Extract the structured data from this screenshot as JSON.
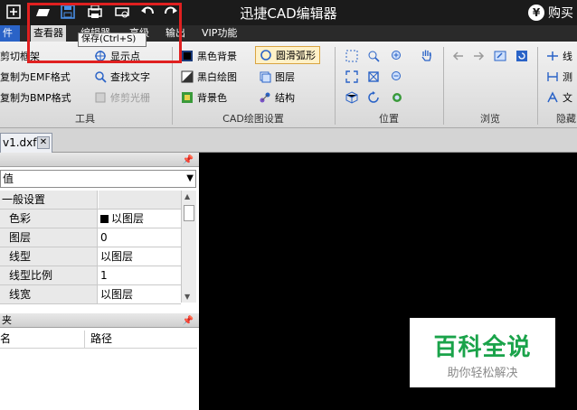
{
  "app": {
    "title": "迅捷CAD编辑器",
    "buy_label": "购买",
    "buy_icon": "yen-icon"
  },
  "quick_access": [
    "new-icon",
    "open-icon",
    "save-icon",
    "print-icon",
    "print-preview-icon",
    "undo-icon",
    "redo-icon"
  ],
  "menu": {
    "tabs": [
      "件",
      "查看器",
      "编辑器",
      "高级",
      "输出",
      "VIP功能"
    ],
    "active_tab": "查看器"
  },
  "tooltip": "保存(Ctrl+S)",
  "ribbon": {
    "tools": {
      "label": "工具",
      "items": [
        {
          "label": "剪切框架",
          "icon": "scissors-icon"
        },
        {
          "label": "复制为EMF格式",
          "icon": "copy-emf-icon"
        },
        {
          "label": "复制为BMP格式",
          "icon": "copy-bmp-icon"
        },
        {
          "label": "显示点",
          "icon": "crosshair-icon"
        },
        {
          "label": "查找文字",
          "icon": "find-text-icon"
        },
        {
          "label": "修剪光栅",
          "icon": "trim-raster-icon"
        }
      ]
    },
    "cad_settings": {
      "label": "CAD绘图设置",
      "items": [
        {
          "label": "黑色背景",
          "icon": "black-bg-icon"
        },
        {
          "label": "黑白绘图",
          "icon": "bw-drawing-icon"
        },
        {
          "label": "背景色",
          "icon": "bg-color-icon"
        },
        {
          "label": "圆滑弧形",
          "icon": "smooth-arc-icon"
        },
        {
          "label": "图层",
          "icon": "layers-icon"
        },
        {
          "label": "结构",
          "icon": "structure-icon"
        }
      ]
    },
    "position": {
      "label": "位置"
    },
    "browse": {
      "label": "浏览"
    },
    "hide": {
      "label": "隐藏",
      "items": [
        {
          "label": "线",
          "icon": "line-icon"
        },
        {
          "label": "测",
          "icon": "measure-icon"
        },
        {
          "label": "文",
          "icon": "text-icon"
        }
      ]
    }
  },
  "document_tab": {
    "name": "v1.dxf"
  },
  "properties": {
    "header": "",
    "combo_value": "值",
    "category": "一般设置",
    "rows": [
      {
        "key": "色彩",
        "value": "以图层",
        "swatch": "#000000"
      },
      {
        "key": "图层",
        "value": "0"
      },
      {
        "key": "线型",
        "value": "以图层"
      },
      {
        "key": "线型比例",
        "value": "1"
      },
      {
        "key": "线宽",
        "value": "以图层"
      }
    ]
  },
  "files_panel": {
    "header": "夹",
    "columns": [
      "名",
      "路径"
    ]
  },
  "watermark": {
    "title": "百科全说",
    "subtitle": "助你轻松解决"
  },
  "colors": {
    "title_bar": "#1b1b1b",
    "file_tab": "#2a63c7",
    "highlight": "#e02020",
    "watermark_green": "#1aa34a"
  }
}
